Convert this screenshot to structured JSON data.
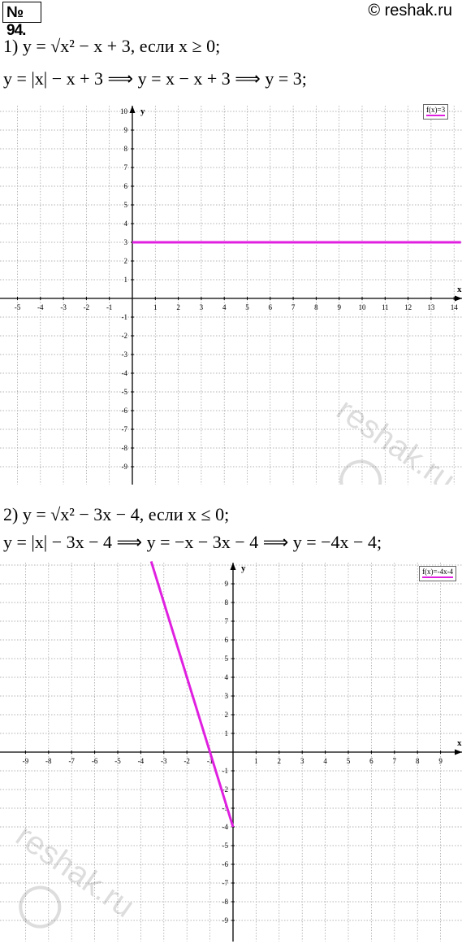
{
  "header": {
    "problem_number": "№ 94.",
    "copyright": "© reshak.ru"
  },
  "part1": {
    "line1": "1) y = √x² − x + 3, если x ≥ 0;",
    "line2": "y = |x| − x + 3 ⟹ y = x − x + 3 ⟹ y = 3;",
    "legend": "f(x)=3"
  },
  "part2": {
    "line1": "2) y = √x² − 3x − 4, если x ≤ 0;",
    "line2": "y = |x| − 3x − 4 ⟹ y = −x − 3x − 4 ⟹ y = −4x − 4;",
    "legend": "f(x)=-4x-4"
  },
  "watermark": "reshak.ru",
  "colors": {
    "plot_line": "#e020e0",
    "grid": "#9a9a9a"
  },
  "chart_data": [
    {
      "type": "line",
      "title": "",
      "xlabel": "x",
      "ylabel": "y",
      "xlim": [
        -5.5,
        14.3
      ],
      "ylim": [
        -9.8,
        10.2
      ],
      "x_ticks": [
        -5,
        -4,
        -3,
        -2,
        -1,
        1,
        2,
        3,
        4,
        5,
        6,
        7,
        8,
        9,
        10,
        11,
        12,
        13,
        14
      ],
      "y_ticks": [
        -9,
        -8,
        -7,
        -6,
        -5,
        -4,
        -3,
        -2,
        -1,
        1,
        2,
        3,
        4,
        5,
        6,
        7,
        8,
        9,
        10
      ],
      "grid": true,
      "legend_position": "top-right",
      "series": [
        {
          "name": "f(x)=3",
          "x": [
            0,
            14.3
          ],
          "y": [
            3,
            3
          ]
        }
      ]
    },
    {
      "type": "line",
      "title": "",
      "xlabel": "x",
      "ylabel": "y",
      "xlim": [
        -9.7,
        9.7
      ],
      "ylim": [
        -9.8,
        10.2
      ],
      "x_ticks": [
        -9,
        -8,
        -7,
        -6,
        -5,
        -4,
        -3,
        -2,
        -1,
        1,
        2,
        3,
        4,
        5,
        6,
        7,
        8,
        9
      ],
      "y_ticks": [
        -9,
        -8,
        -7,
        -6,
        -5,
        -4,
        -3,
        -2,
        -1,
        1,
        2,
        3,
        4,
        5,
        6,
        7,
        8,
        9
      ],
      "grid": true,
      "legend_position": "top-right",
      "series": [
        {
          "name": "f(x)=-4x-4",
          "x": [
            -3.55,
            0
          ],
          "y": [
            10.2,
            -4
          ]
        }
      ]
    }
  ]
}
